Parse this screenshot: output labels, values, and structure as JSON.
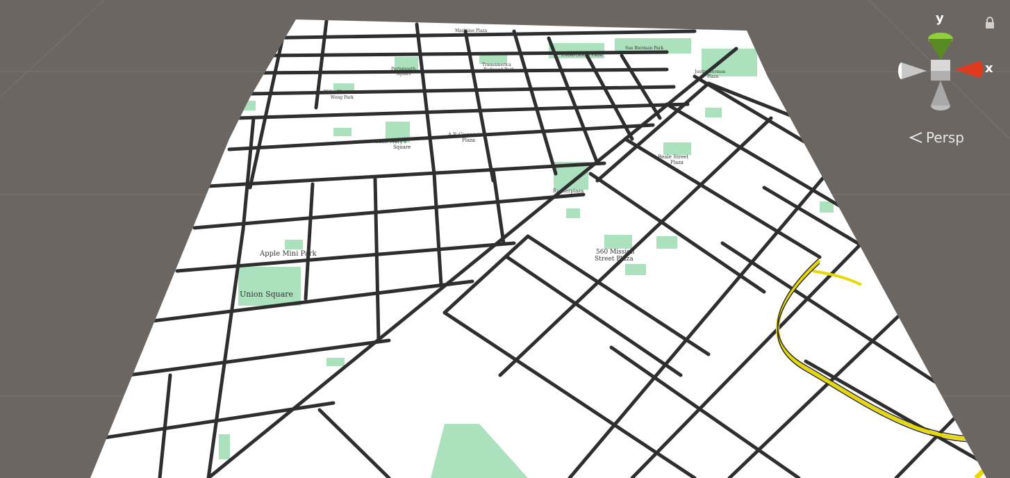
{
  "scene": {
    "background_color": "#6b6662",
    "map_fill": "#ffffff",
    "road_color": "#2e2e2e",
    "park_color": "#9edcb3",
    "highway_color": "#f0e000"
  },
  "map_labels": {
    "union_square": "Union Square",
    "apple_mini_park": "Apple Mini Park",
    "mission_plaza_line1": "560 Mission",
    "mission_plaza_line2": "Street Plaza",
    "saint_mary_line1": "Saint Mary's",
    "saint_mary_line2": "Square",
    "giannini_line1": "A.P. Giannini",
    "giannini_line2": "Plaza",
    "beale_line1": "Beale Street",
    "beale_line2": "Plaza",
    "rusher_plaza": "Rusherplaza",
    "willie_line1": "Willie Woo",
    "willie_line2": "Wong Park",
    "portsmouth_line1": "Portsmouth",
    "portsmouth_line2": "Square",
    "transamerica_line1": "Transamerica",
    "transamerica_line2": "Redwood Park",
    "sue_bierman": "Sue Bierman Park",
    "embarcadero_plaza": "Embarcadero Plaza",
    "justin_herman_line1": "Justin Herman",
    "justin_herman_line2": "Plaza",
    "top_label": "Maritime Plaza"
  },
  "gizmo": {
    "y_label": "y",
    "x_label": "x",
    "y_axis_color": "#8fd13a",
    "x_axis_color": "#e03a1e",
    "neutral_color": "#d0d0d0",
    "view_mode": "Persp",
    "lock_icon": "lock-icon"
  }
}
